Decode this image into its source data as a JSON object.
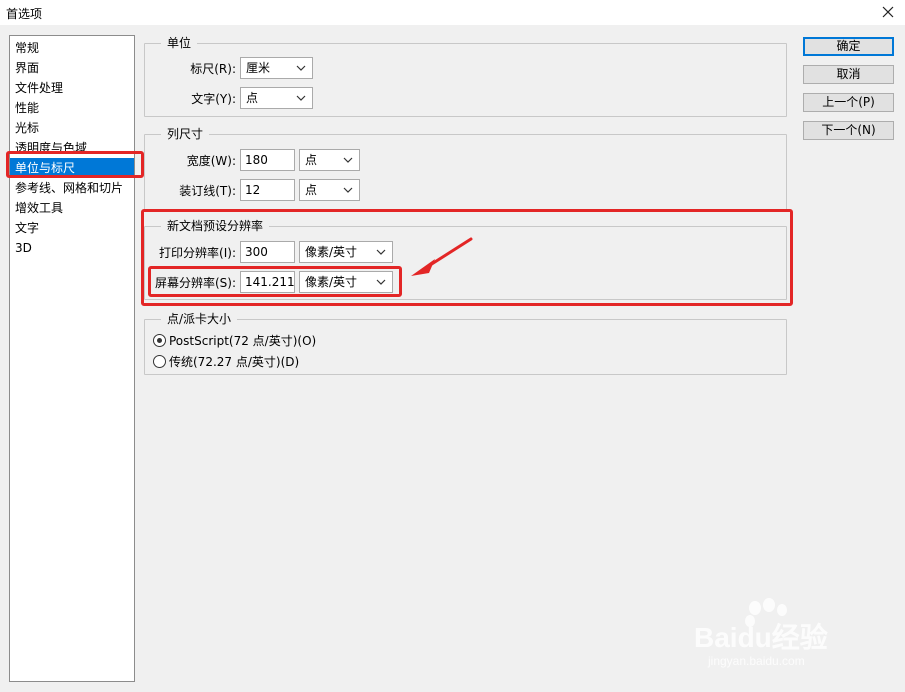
{
  "window": {
    "title": "首选项"
  },
  "sidebar": {
    "items": [
      {
        "label": "常规"
      },
      {
        "label": "界面"
      },
      {
        "label": "文件处理"
      },
      {
        "label": "性能"
      },
      {
        "label": "光标"
      },
      {
        "label": "透明度与色域"
      },
      {
        "label": "单位与标尺"
      },
      {
        "label": "参考线、网格和切片"
      },
      {
        "label": "增效工具"
      },
      {
        "label": "文字"
      },
      {
        "label": "3D"
      }
    ],
    "selected": "单位与标尺"
  },
  "units": {
    "legend": "单位",
    "rulers": {
      "label": "标尺(R):",
      "value": "厘米"
    },
    "type": {
      "label": "文字(Y):",
      "value": "点"
    }
  },
  "column_size": {
    "legend": "列尺寸",
    "width": {
      "label": "宽度(W):",
      "value": "180",
      "unit": "点"
    },
    "gutter": {
      "label": "装订线(T):",
      "value": "12",
      "unit": "点"
    }
  },
  "preset_resolution": {
    "legend": "新文档预设分辨率",
    "print": {
      "label": "打印分辨率(I):",
      "value": "300",
      "unit": "像素/英寸"
    },
    "screen": {
      "label": "屏幕分辨率(S):",
      "value": "141.211",
      "unit": "像素/英寸"
    }
  },
  "point_size": {
    "legend": "点/派卡大小",
    "postscript": {
      "label": "PostScript(72 点/英寸)(O)",
      "checked": true
    },
    "traditional": {
      "label": "传统(72.27 点/英寸)(D)",
      "checked": false
    }
  },
  "buttons": {
    "ok": "确定",
    "cancel": "取消",
    "prev": "上一个(P)",
    "next": "下一个(N)"
  },
  "watermark": {
    "brand": "Baidu经验",
    "url": "jingyan.baidu.com"
  },
  "colors": {
    "accent": "#0078d7",
    "highlight": "#e32626"
  }
}
